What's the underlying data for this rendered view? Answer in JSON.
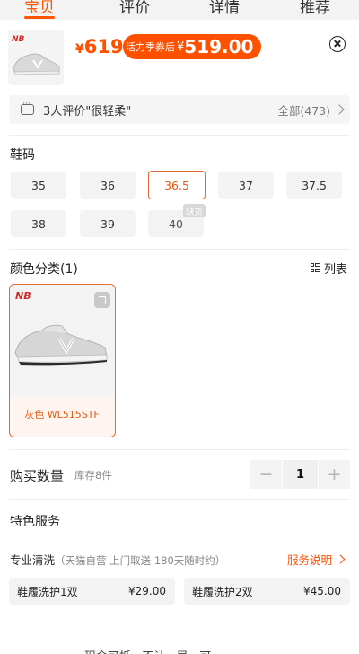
{
  "tabs": [
    {
      "label": "宝贝",
      "active": true
    },
    {
      "label": "评价",
      "active": false
    },
    {
      "label": "详情",
      "active": false
    },
    {
      "label": "推荐",
      "active": false
    }
  ],
  "product": {
    "currency": "¥",
    "price": "619",
    "promo_label": "活力季券后",
    "promo_price": "519.00"
  },
  "reviews": {
    "summary": "3人评价\"很轻柔\"",
    "all_label": "全部(473)"
  },
  "size": {
    "title": "鞋码",
    "options": [
      "35",
      "36",
      "36.5",
      "37",
      "37.5",
      "38",
      "39",
      "40"
    ],
    "selected": "36.5",
    "sold_out_badge": "缺货"
  },
  "color": {
    "title": "颜色分类(1)",
    "list_toggle": "列表",
    "options": [
      {
        "label": "灰色 WL515STF"
      }
    ]
  },
  "quantity": {
    "title": "购买数量",
    "stock": "库存8件",
    "minus": "−",
    "value": "1",
    "plus": "+"
  },
  "services": {
    "title": "特色服务",
    "category": "专业清洗",
    "category_desc": "（天猫自营 上门取送 180天随时约）",
    "info_link": "服务说明",
    "options": [
      {
        "name": "鞋履洗护1双",
        "price": "¥29.00"
      },
      {
        "name": "鞋履洗护2双",
        "price": "¥45.00"
      }
    ]
  },
  "footer_partial": "现金可抵 · 不计 · 异...可",
  "colors": {
    "accent": "#ff5000",
    "chip_bg": "#f3f3f3"
  }
}
